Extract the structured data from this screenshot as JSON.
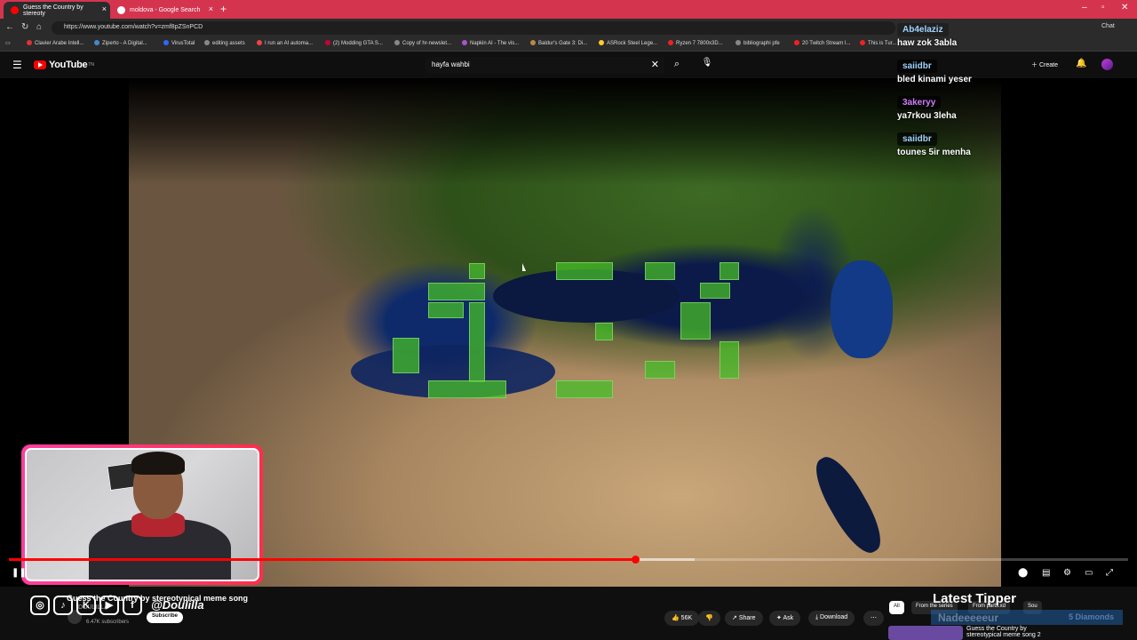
{
  "browser": {
    "tabs": [
      {
        "title": "Guess the Country by stereoty",
        "active": true,
        "icon": "youtube-icon"
      },
      {
        "title": "moldova - Google Search",
        "active": false,
        "icon": "google-icon"
      }
    ],
    "url": "https://www.youtube.com/watch?v=zmf8pZSnPCD",
    "bookmarks": [
      "Clavier Arabe Intell...",
      "Ziperto - A Digital...",
      "VirusTotal",
      "editing assets",
      "I run an AI automa...",
      "(2) Modding GTA S...",
      "Copy of hr-newslet...",
      "Napkin AI - The vis...",
      "Baldur's Gate 3: Di...",
      "ASRock Steel Lege...",
      "Ryzen 7 7800x3D...",
      "bibliographi pfe",
      "20 Twitch Stream I...",
      "This is Tur..."
    ],
    "chat_label": "Chat"
  },
  "youtube": {
    "logo_text": "YouTube",
    "logo_country": "TN",
    "search_query": "hayfa wahbi",
    "create_label": "Create",
    "video": {
      "title": "Guess the Country by stereotypical meme song",
      "channel": "DOULILLA",
      "subscribers": "6.47K subscribers",
      "subscribe_label": "Subscribe",
      "progress": 0.56,
      "likes": "56K",
      "share_label": "Share",
      "ask_label": "Ask",
      "download_label": "Download"
    },
    "recommendations": {
      "chips": [
        "All",
        "From the series",
        "From parts.xd",
        "Sou"
      ],
      "first_title": "Guess the Country by",
      "first_subtitle": "stereotypical meme song 2"
    }
  },
  "overlay": {
    "social_handle": "@Doulilla",
    "chat": [
      {
        "user": "Ab4elaziz",
        "text": "haw zok 3abla",
        "color": "#9fd3ff"
      },
      {
        "user": "saiidbr",
        "text": "bled kinami yeser",
        "color": "#9fd3ff"
      },
      {
        "user": "3akeryy",
        "text": "ya7rkou 3leha",
        "color": "#d07cff"
      },
      {
        "user": "saiidbr",
        "text": "tounes 5ir menha",
        "color": "#9fd3ff"
      }
    ],
    "latest_tipper_label": "Latest Tipper",
    "latest_tipper_name": "Nadeeeeeur",
    "latest_tipper_amount": "5 Diamonds"
  },
  "colors": {
    "tab_strip": "#d5344f",
    "yt_red": "#ff0000",
    "cam_border": "#ff3fa0"
  }
}
